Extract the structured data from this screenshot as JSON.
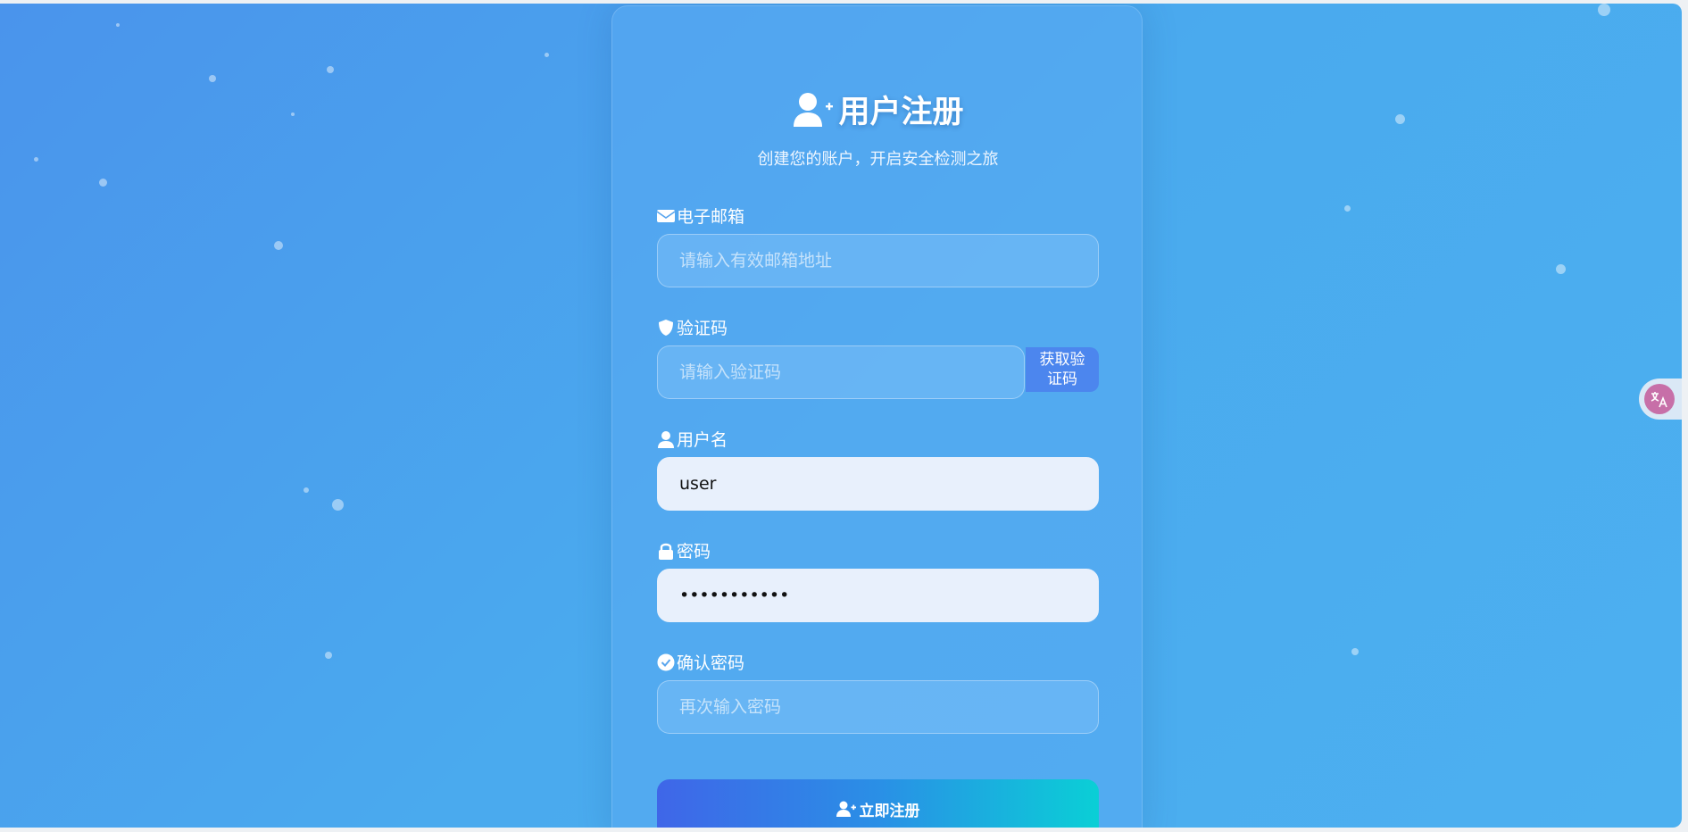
{
  "form": {
    "title": "用户注册",
    "subtitle": "创建您的账户，开启安全检测之旅",
    "email": {
      "label": "电子邮箱",
      "placeholder": "请输入有效邮箱地址",
      "value": ""
    },
    "code": {
      "label": "验证码",
      "placeholder": "请输入验证码",
      "value": "",
      "button": "获取验证码"
    },
    "username": {
      "label": "用户名",
      "placeholder": "",
      "value": "user"
    },
    "password": {
      "label": "密码",
      "placeholder": "",
      "value": "•••••••••••"
    },
    "confirm": {
      "label": "确认密码",
      "placeholder": "再次输入密码",
      "value": ""
    },
    "submit_label": "立即注册"
  },
  "icons": {
    "title": "user-plus-icon",
    "email": "envelope-icon",
    "code": "shield-icon",
    "username": "user-icon",
    "password": "lock-icon",
    "confirm": "check-circle-icon",
    "submit": "user-plus-icon",
    "translate": "translate-icon"
  },
  "colors": {
    "background": "#4a9eee",
    "accent_start": "#3f66e8",
    "accent_end": "#0acfd6",
    "code_button": "#4c86ee",
    "translate_badge": "#c76fa8"
  }
}
